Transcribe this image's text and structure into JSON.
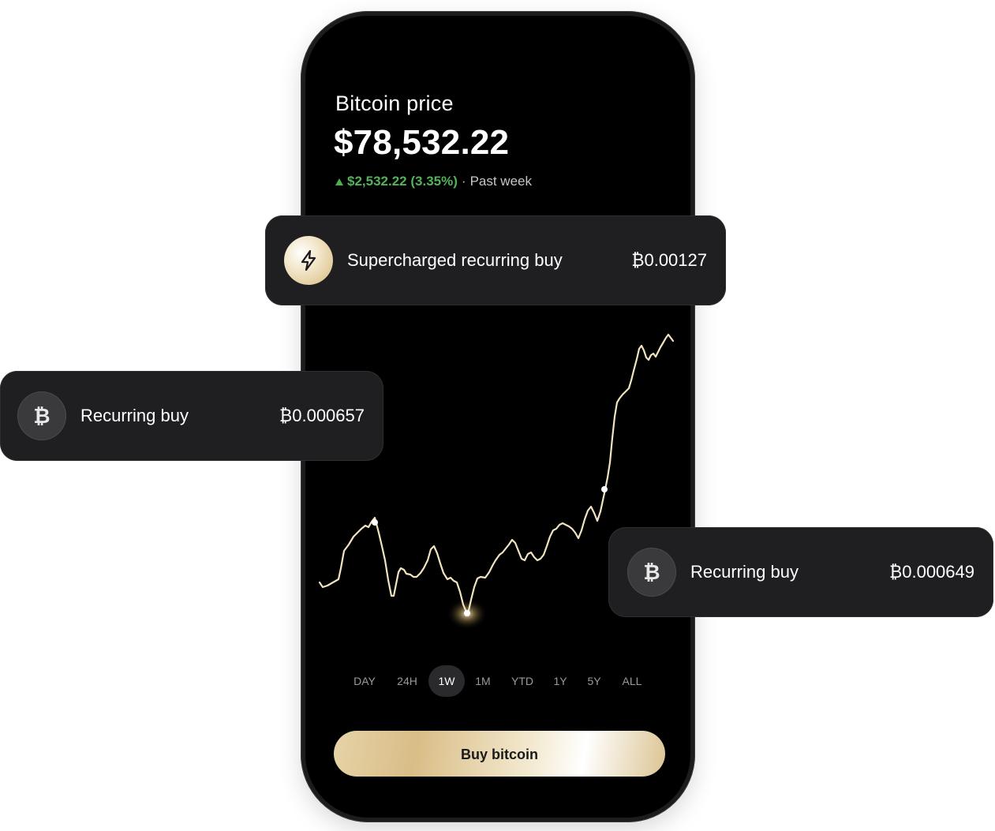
{
  "price": {
    "title": "Bitcoin price",
    "value": "$78,532.22",
    "change": "$2,532.22 (3.35%)",
    "separator": "·",
    "period": "Past week",
    "change_color": "#53b35a"
  },
  "cards": {
    "supercharged": {
      "label": "Supercharged recurring buy",
      "amount": "₿0.00127",
      "icon": "lightning-icon"
    },
    "recurring_left": {
      "label": "Recurring buy",
      "amount": "₿0.000657",
      "icon": "bitcoin-icon"
    },
    "recurring_right": {
      "label": "Recurring buy",
      "amount": "₿0.000649",
      "icon": "bitcoin-icon"
    }
  },
  "range_tabs": [
    "DAY",
    "24H",
    "1W",
    "1M",
    "YTD",
    "1Y",
    "5Y",
    "ALL"
  ],
  "active_tab": "1W",
  "buy_button": "Buy bitcoin",
  "colors": {
    "line": "#f1e3bf",
    "accent_gold": "#d9bd86"
  }
}
